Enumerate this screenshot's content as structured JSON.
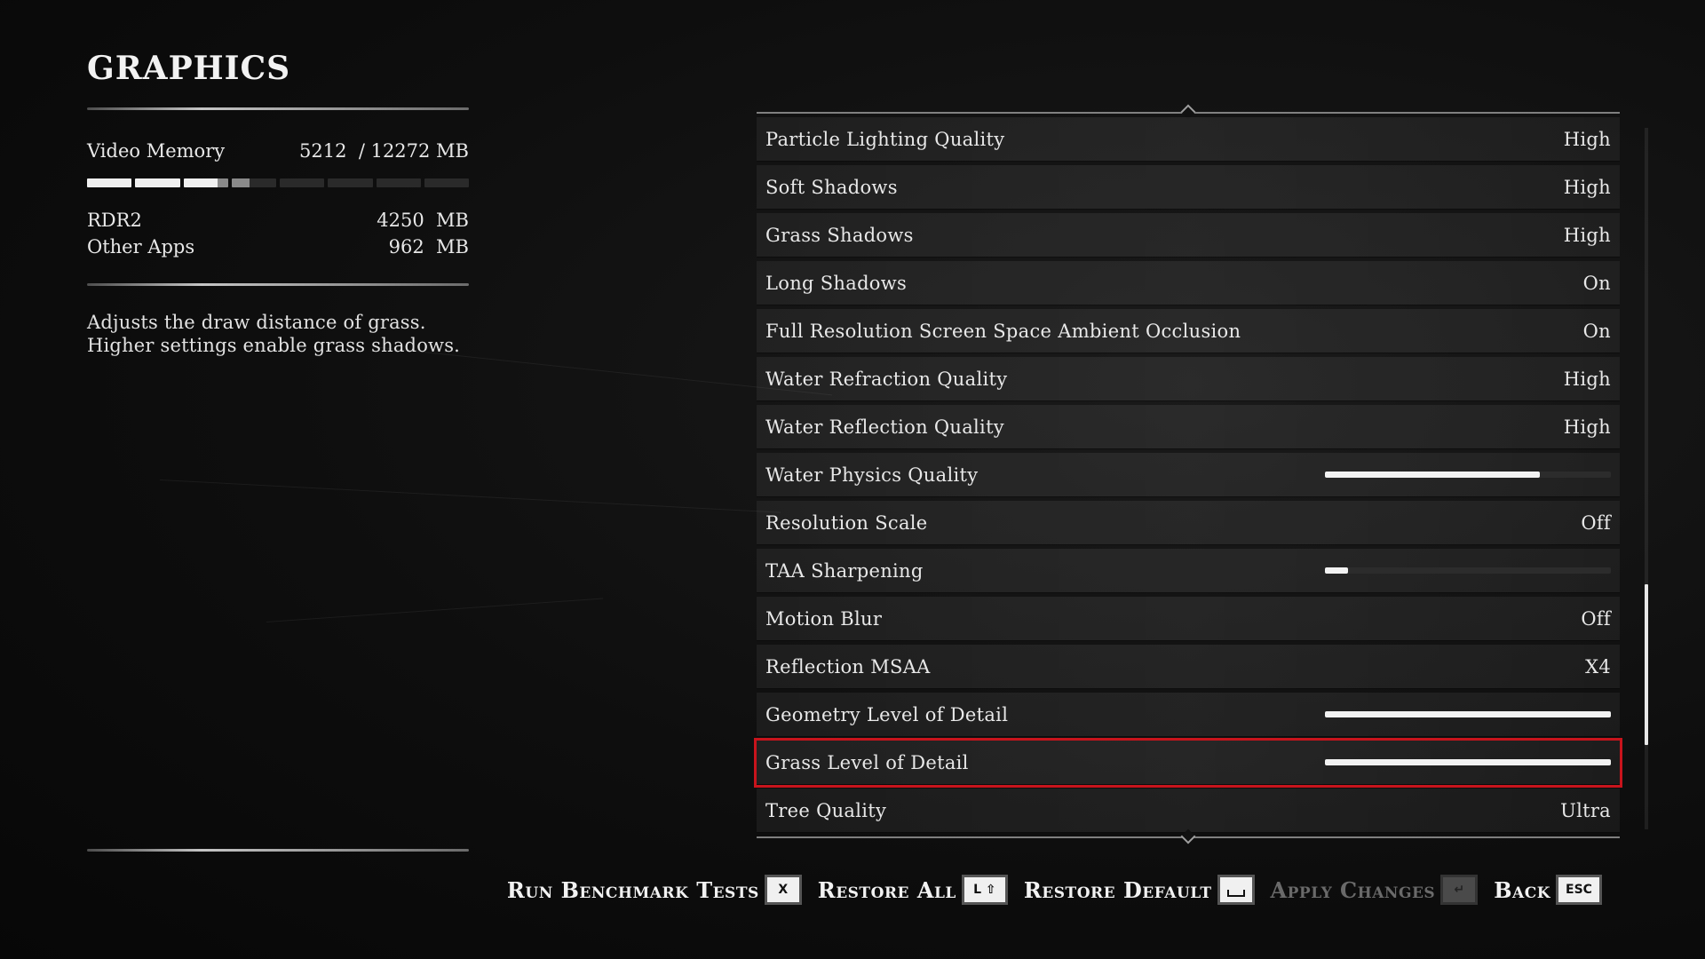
{
  "page_title": "GRAPHICS",
  "memory": {
    "label": "Video Memory",
    "used": "5212",
    "total_text": "/ 12272 MB",
    "usage_fraction": 0.4247,
    "rdr2_fraction": 0.3463,
    "segments": 8,
    "details": [
      {
        "label": "RDR2",
        "value": "4250  MB"
      },
      {
        "label": "Other Apps",
        "value": "962  MB"
      }
    ]
  },
  "description": "Adjusts the draw distance of grass. Higher settings enable grass shadows.",
  "settings": [
    {
      "label": "Particle Lighting Quality",
      "type": "text",
      "value": "High"
    },
    {
      "label": "Soft Shadows",
      "type": "text",
      "value": "High"
    },
    {
      "label": "Grass Shadows",
      "type": "text",
      "value": "High"
    },
    {
      "label": "Long Shadows",
      "type": "text",
      "value": "On"
    },
    {
      "label": "Full Resolution Screen Space Ambient Occlusion",
      "type": "text",
      "value": "On"
    },
    {
      "label": "Water Refraction Quality",
      "type": "text",
      "value": "High"
    },
    {
      "label": "Water Reflection Quality",
      "type": "text",
      "value": "High"
    },
    {
      "label": "Water Physics Quality",
      "type": "slider",
      "level": 0.75
    },
    {
      "label": "Resolution Scale",
      "type": "text",
      "value": "Off"
    },
    {
      "label": "TAA Sharpening",
      "type": "slider",
      "level": 0.08
    },
    {
      "label": "Motion Blur",
      "type": "text",
      "value": "Off"
    },
    {
      "label": "Reflection MSAA",
      "type": "text",
      "value": "X4"
    },
    {
      "label": "Geometry Level of Detail",
      "type": "slider",
      "level": 1.0
    },
    {
      "label": "Grass Level of Detail",
      "type": "slider",
      "level": 1.0,
      "selected": true
    },
    {
      "label": "Tree Quality",
      "type": "text",
      "value": "Ultra"
    }
  ],
  "scroll": {
    "thumb_start_fraction": 0.65,
    "thumb_end_fraction": 0.88
  },
  "actions": [
    {
      "label": "Run Benchmark Tests",
      "key": "X",
      "enabled": true,
      "icon": "x-key-icon"
    },
    {
      "label": "Restore All",
      "key": "L ⇧",
      "enabled": true,
      "icon": "shift-key-icon"
    },
    {
      "label": "Restore Default",
      "key": "",
      "enabled": true,
      "icon": "space-key-icon"
    },
    {
      "label": "Apply Changes",
      "key": "↵",
      "enabled": false,
      "icon": "enter-key-icon"
    },
    {
      "label": "Back",
      "key": "ESC",
      "enabled": true,
      "icon": "esc-key-icon"
    }
  ],
  "colors": {
    "selection_outline": "#c8141c",
    "text": "#e8e8e8",
    "background": "#0b0b0b"
  }
}
